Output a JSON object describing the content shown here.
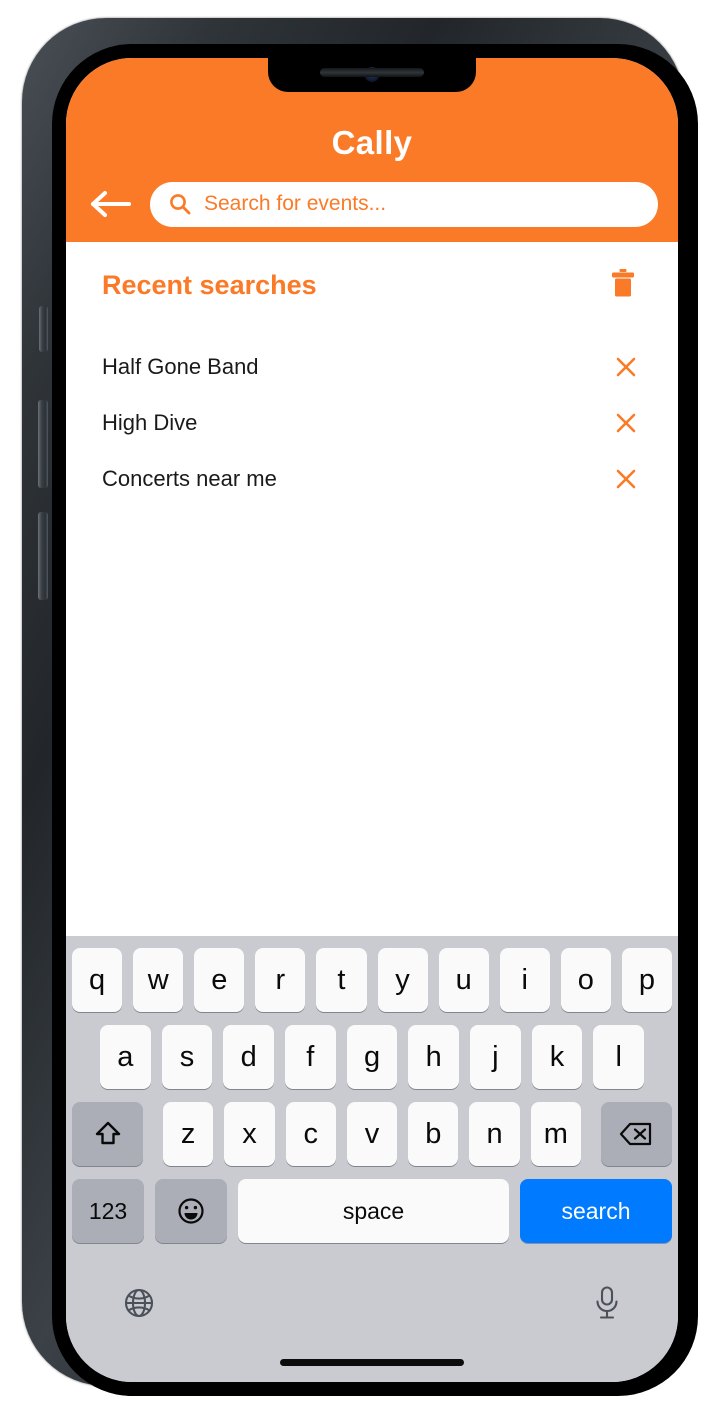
{
  "app": {
    "title": "Cally",
    "accent_color": "#fb7a27",
    "header_background": "#fb7a27",
    "screen_background": "#ffffff"
  },
  "header": {
    "back_icon": "back-arrow-icon",
    "search": {
      "icon": "search-icon",
      "placeholder": "Search for events...",
      "value": ""
    }
  },
  "content": {
    "recent": {
      "title": "Recent searches",
      "clear_all_icon": "trash-icon",
      "items": [
        {
          "label": "Half Gone Band",
          "remove_icon": "close-icon"
        },
        {
          "label": "High Dive",
          "remove_icon": "close-icon"
        },
        {
          "label": "Concerts near me",
          "remove_icon": "close-icon"
        }
      ]
    }
  },
  "keyboard": {
    "background_color": "#c9cbd1",
    "key_color": "#fafafa",
    "modifier_key_color": "#abaeb7",
    "action_key_color": "#007aff",
    "row1": [
      "q",
      "w",
      "e",
      "r",
      "t",
      "y",
      "u",
      "i",
      "o",
      "p"
    ],
    "row2": [
      "a",
      "s",
      "d",
      "f",
      "g",
      "h",
      "j",
      "k",
      "l"
    ],
    "row3": [
      "z",
      "x",
      "c",
      "v",
      "b",
      "n",
      "m"
    ],
    "shift_icon": "shift-icon",
    "backspace_icon": "backspace-icon",
    "numbers_label": "123",
    "emoji_icon": "emoji-icon",
    "space_label": "space",
    "search_label": "search",
    "globe_icon": "globe-icon",
    "dictation_icon": "microphone-icon"
  }
}
